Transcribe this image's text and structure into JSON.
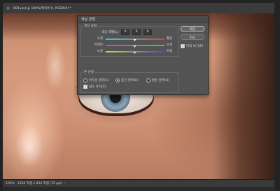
{
  "document": {
    "tab_title": "004.psd @ 100%(레이어 0, RGB/8#) *",
    "close_glyph": "×"
  },
  "status_bar": {
    "zoom": "100%",
    "doc_info": "1200 픽셀 x 834 픽셀 (72 ppi)",
    "arrow": "›"
  },
  "dialog": {
    "title": "색상 균형",
    "color_balance_group": "색상 균형",
    "levels_label": "색상 레벨(L):",
    "levels": [
      "0",
      "0",
      "0"
    ],
    "sliders": [
      {
        "left": "녹청",
        "right": "빨강",
        "value": 0,
        "gradient": [
          "#2fd0d0",
          "#e03a3a"
        ]
      },
      {
        "left": "마젠타",
        "right": "녹색",
        "value": 0,
        "gradient": [
          "#d040d0",
          "#3ad03a"
        ]
      },
      {
        "left": "노랑",
        "right": "파랑",
        "value": 0,
        "gradient": [
          "#e0d030",
          "#3a50e0"
        ]
      }
    ],
    "tone_balance_group": "톤 균형",
    "tones": [
      {
        "label": "어두운 영역(S)",
        "selected": false
      },
      {
        "label": "중간 영역(D)",
        "selected": true
      },
      {
        "label": "밝은 영역(H)",
        "selected": false
      }
    ],
    "preserve_luminosity": {
      "label": "광도 유지(V)",
      "checked": true
    },
    "ok_label": "확인",
    "cancel_label": "취소",
    "preview": {
      "label": "미리 보기(P)",
      "checked": true
    },
    "check_glyph": "✓"
  }
}
